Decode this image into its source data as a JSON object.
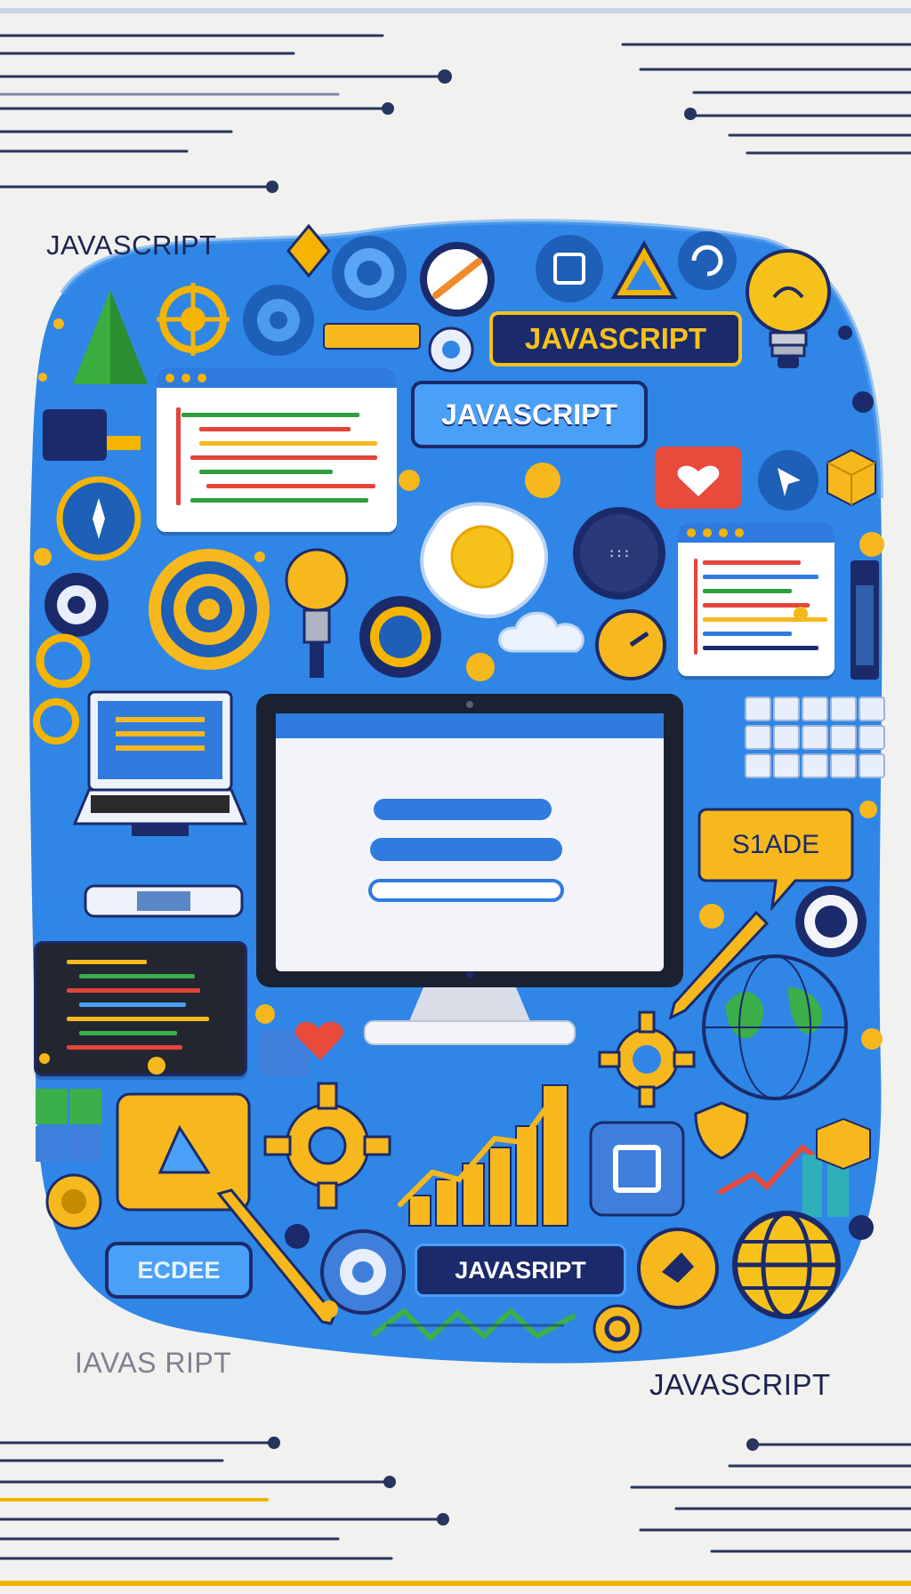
{
  "labels": {
    "top_left": "JAVASCRIPT",
    "banner_top": "JAVASCRIPT",
    "blue_button": "JAVASCRIPT",
    "speech_bubble": "S1ADE",
    "bottom_left_button": "ECDEE",
    "bottom_dark_button": "JAVASRIPT",
    "faded_bottom_left": "IAVAS RIPT",
    "bottom_right": "JAVASCRIPT"
  },
  "colors": {
    "background": "#f1f1ef",
    "blob_blue": "#2f86e6",
    "accent_yellow": "#f6b81c",
    "navy": "#1b2a6b",
    "red": "#e84a3c",
    "green": "#3cae4a"
  },
  "icons": [
    "pyramid-icon",
    "target-icon",
    "gear-icon",
    "lightbulb-icon",
    "heart-icon",
    "globe-icon",
    "laptop-icon",
    "monitor-icon",
    "bar-chart-icon",
    "pencil-icon",
    "cloud-icon",
    "egg-icon",
    "cube-icon",
    "calculator-icon",
    "speech-bubble-icon"
  ]
}
